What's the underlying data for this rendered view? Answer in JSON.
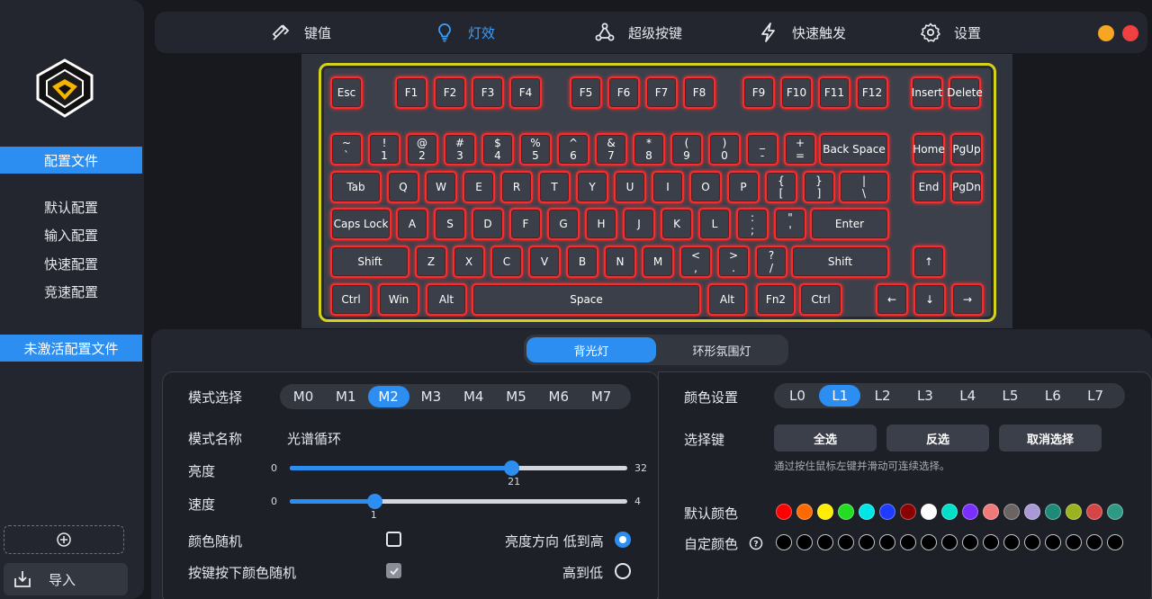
{
  "sidebar": {
    "section_config": "配置文件",
    "items": [
      "默认配置",
      "输入配置",
      "快速配置",
      "竞速配置"
    ],
    "section_inactive": "未激活配置文件",
    "import_label": "导入"
  },
  "topbar": {
    "tabs": [
      {
        "label": "键值",
        "icon": "keycap-icon"
      },
      {
        "label": "灯效",
        "icon": "lightbulb-icon"
      },
      {
        "label": "超级按键",
        "icon": "nodes-icon"
      },
      {
        "label": "快速触发",
        "icon": "lightning-icon"
      },
      {
        "label": "设置",
        "icon": "gear-icon"
      }
    ],
    "active_tab": "灯效",
    "window_colors": {
      "minimize": "#f5a623",
      "close": "#f04040"
    }
  },
  "keyboard": {
    "rows": [
      [
        "Esc",
        "F1",
        "F2",
        "F3",
        "F4",
        "F5",
        "F6",
        "F7",
        "F8",
        "F9",
        "F10",
        "F11",
        "F12",
        "Insert",
        "Delete"
      ],
      [
        "~\n`",
        "!\n1",
        "@\n2",
        "#\n3",
        "$\n4",
        "%\n5",
        "^\n6",
        "&\n7",
        "*\n8",
        "(\n9",
        ")\n0",
        "_\n-",
        "+\n=",
        "Back Space",
        "Home",
        "PgUp"
      ],
      [
        "Tab",
        "Q",
        "W",
        "E",
        "R",
        "T",
        "Y",
        "U",
        "I",
        "O",
        "P",
        "{\n[",
        "}\n]",
        "|\n\\",
        "End",
        "PgDn"
      ],
      [
        "Caps Lock",
        "A",
        "S",
        "D",
        "F",
        "G",
        "H",
        "J",
        "K",
        "L",
        ":\n;",
        "\"\n'",
        "Enter"
      ],
      [
        "Shift",
        "Z",
        "X",
        "C",
        "V",
        "B",
        "N",
        "M",
        "<\n,",
        ">\n.",
        "?\n/",
        "Shift",
        "↑"
      ],
      [
        "Ctrl",
        "Win",
        "Alt",
        "Space",
        "Alt",
        "Fn2",
        "Ctrl",
        "←",
        "↓",
        "→"
      ]
    ],
    "glow_color": "#ff2a2a",
    "frame_color": "#d5d21b"
  },
  "light_tabs": [
    "背光灯",
    "环形氛围灯"
  ],
  "active_light_tab": "背光灯",
  "left_panel": {
    "mode_label": "模式选择",
    "modes": [
      "M0",
      "M1",
      "M2",
      "M3",
      "M4",
      "M5",
      "M6",
      "M7"
    ],
    "active_mode": "M2",
    "mode_name_label": "模式名称",
    "mode_name": "光谱循环",
    "brightness_label": "亮度",
    "brightness": {
      "min": "0",
      "max": "32",
      "value": "21"
    },
    "speed_label": "速度",
    "speed": {
      "min": "0",
      "max": "4",
      "value": "1"
    },
    "color_random_label": "颜色随机",
    "brightness_dir_label": "亮度方向 低到高",
    "high_to_low_label": "高到低",
    "keypress_random_label": "按键按下颜色随机"
  },
  "right_panel": {
    "color_setting_label": "颜色设置",
    "layers": [
      "L0",
      "L1",
      "L2",
      "L3",
      "L4",
      "L5",
      "L6",
      "L7"
    ],
    "active_layer": "L1",
    "select_key_label": "选择键",
    "buttons": [
      "全选",
      "反选",
      "取消选择"
    ],
    "hint": "通过按住鼠标左键并滑动可连续选择。",
    "default_color_label": "默认颜色",
    "default_colors": [
      "#ff0000",
      "#ff6a00",
      "#ffee00",
      "#22dd22",
      "#00e6e6",
      "#1f3bff",
      "#8b0000",
      "#ffffff",
      "#00e0c8",
      "#7b2fff",
      "#f07a7a",
      "#6b6463",
      "#a99ad6",
      "#1f8a7a",
      "#9ab31f",
      "#d64545",
      "#2e9a86"
    ],
    "custom_color_label": "自定颜色",
    "custom_color_count": 17
  }
}
